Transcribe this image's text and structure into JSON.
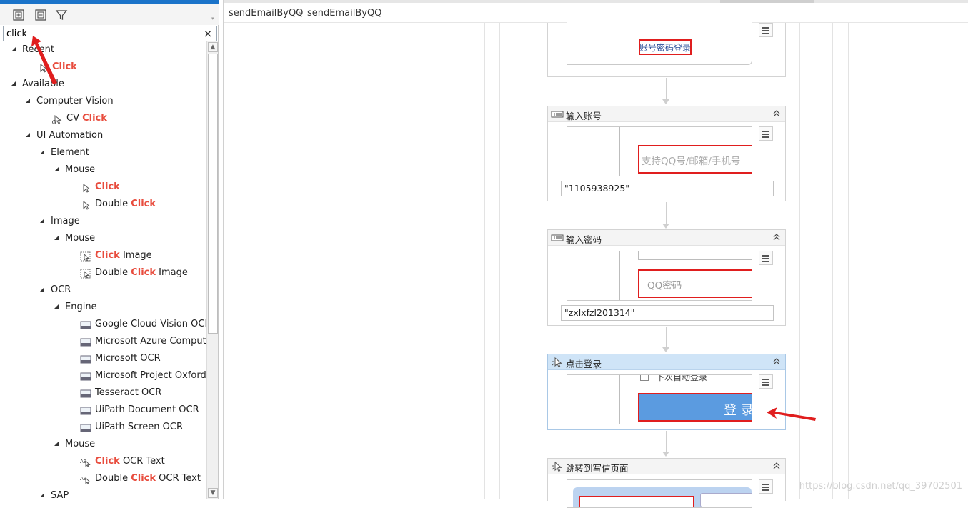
{
  "search": {
    "value": "click",
    "clear_glyph": "×"
  },
  "toolbar": {
    "expand_all_icon": "expand-all-icon",
    "collapse_all_icon": "collapse-all-icon",
    "filter_icon": "filter-icon"
  },
  "tree": {
    "recent": "Recent",
    "recent_click": "Click",
    "available": "Available",
    "computer_vision": "Computer Vision",
    "cv_prefix": "CV ",
    "cv_click": "Click",
    "ui_automation": "UI Automation",
    "element": "Element",
    "element_mouse": "Mouse",
    "element_click": "Click",
    "double_prefix": "Double ",
    "double_click": "Click",
    "image": "Image",
    "image_mouse": "Mouse",
    "click_image_hl": "Click",
    "click_image_rest": " Image",
    "double_click_image_prefix": "Double ",
    "double_click_image_hl": "Click",
    "double_click_image_rest": " Image",
    "ocr": "OCR",
    "engine": "Engine",
    "engines": [
      "Google Cloud Vision OCR",
      "Microsoft Azure Computer",
      "Microsoft OCR",
      "Microsoft Project Oxford O",
      "Tesseract OCR",
      "UiPath Document OCR",
      "UiPath Screen OCR"
    ],
    "ocr_mouse": "Mouse",
    "click_ocr_hl": "Click",
    "click_ocr_rest": " OCR Text",
    "double_click_ocr_prefix": "Double ",
    "double_click_ocr_hl": "Click",
    "double_click_ocr_rest": " OCR Text",
    "sap": "SAP"
  },
  "breadcrumb": {
    "first": "sendEmailByQQ",
    "second": "sendEmailByQQ",
    "separator": "›"
  },
  "activities": {
    "first": {
      "target_text": "账号密码登录"
    },
    "type_account": {
      "title": "输入账号",
      "placeholder": "支持QQ号/邮箱/手机号",
      "value": "\"1105938925\""
    },
    "type_password": {
      "title": "输入密码",
      "placeholder": "QQ密码",
      "value": "\"zxlxfzl201314\""
    },
    "click_login": {
      "title": "点击登录",
      "checkbox_text": "下次自动登录",
      "button_text": "登 录"
    },
    "goto_compose": {
      "title": "跳转到写信页面"
    }
  },
  "watermark": "https://blog.csdn.net/qq_39702501",
  "colors": {
    "accent": "#1a73c9",
    "highlight": "#e84c3d",
    "annotation_red": "#e01e1e",
    "login_blue": "#5b9be0"
  }
}
